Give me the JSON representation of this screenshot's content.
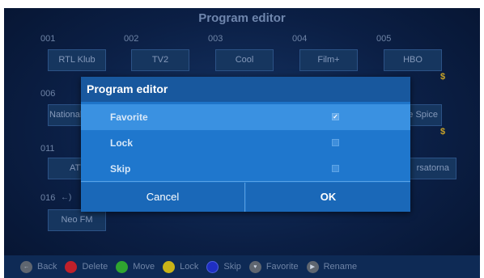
{
  "background": {
    "title": "Program editor",
    "channels": [
      {
        "num": "001",
        "name": "RTL Klub"
      },
      {
        "num": "002",
        "name": "TV2"
      },
      {
        "num": "003",
        "name": "Cool"
      },
      {
        "num": "004",
        "name": "Film+"
      },
      {
        "num": "005",
        "name": "HBO"
      },
      {
        "num": "006",
        "name": "National"
      },
      {
        "name": "e Spice"
      },
      {
        "num": "011",
        "name": "ATV"
      },
      {
        "name": "rsatorna"
      },
      {
        "num": "016",
        "name": "Neo FM"
      }
    ],
    "dollar": "$",
    "arrow_glyph": "←)"
  },
  "dialog": {
    "title": "Program editor",
    "options": [
      {
        "label": "Favorite",
        "checked": true,
        "check_glyph": "✓"
      },
      {
        "label": "Lock",
        "checked": false,
        "check_glyph": ""
      },
      {
        "label": "Skip",
        "checked": false,
        "check_glyph": ""
      }
    ],
    "cancel_label": "Cancel",
    "ok_label": "OK"
  },
  "bottom_bar": {
    "items": [
      {
        "label": "Back",
        "color": "#5f6670",
        "glyph": "←"
      },
      {
        "label": "Delete",
        "color": "#c0202a",
        "glyph": ""
      },
      {
        "label": "Move",
        "color": "#2fa52f",
        "glyph": ""
      },
      {
        "label": "Lock",
        "color": "#c9b317",
        "glyph": ""
      },
      {
        "label": "Skip",
        "color": "#1f2fc2",
        "glyph": ""
      },
      {
        "label": "Favorite",
        "color": "#5f6670",
        "glyph": "♥"
      },
      {
        "label": "Rename",
        "color": "#5f6670",
        "glyph": "▶"
      }
    ]
  }
}
